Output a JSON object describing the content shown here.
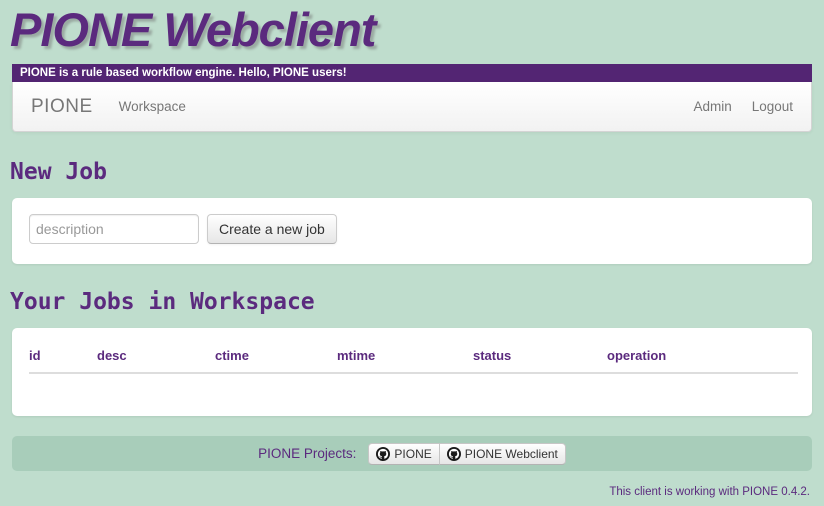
{
  "banner": {
    "title": "PIONE Webclient",
    "subtitle": "PIONE is a rule based workflow engine. Hello, PIONE users!"
  },
  "navbar": {
    "brand": "PIONE",
    "left_links": [
      {
        "label": "Workspace"
      }
    ],
    "right_links": [
      {
        "label": "Admin"
      },
      {
        "label": "Logout"
      }
    ]
  },
  "new_job": {
    "heading": "New Job",
    "description_value": "",
    "description_placeholder": "description",
    "create_button": "Create a new job"
  },
  "jobs": {
    "heading": "Your Jobs in Workspace",
    "columns": [
      {
        "key": "id",
        "label": "id"
      },
      {
        "key": "desc",
        "label": "desc"
      },
      {
        "key": "ctime",
        "label": "ctime"
      },
      {
        "key": "mtime",
        "label": "mtime"
      },
      {
        "key": "status",
        "label": "status"
      },
      {
        "key": "operation",
        "label": "operation"
      }
    ],
    "rows": []
  },
  "footer": {
    "label": "PIONE Projects:",
    "projects": [
      {
        "label": "PIONE",
        "icon": "github-octocat-icon"
      },
      {
        "label": "PIONE Webclient",
        "icon": "github-octocat-icon"
      }
    ],
    "version_note": "This client is working with PIONE 0.4.2."
  },
  "colors": {
    "page_background": "#bfddcd",
    "accent_purple": "#5b2a7e",
    "subtitle_bar": "#532573",
    "footer_bar": "#a8cdba",
    "panel_white": "#ffffff"
  }
}
